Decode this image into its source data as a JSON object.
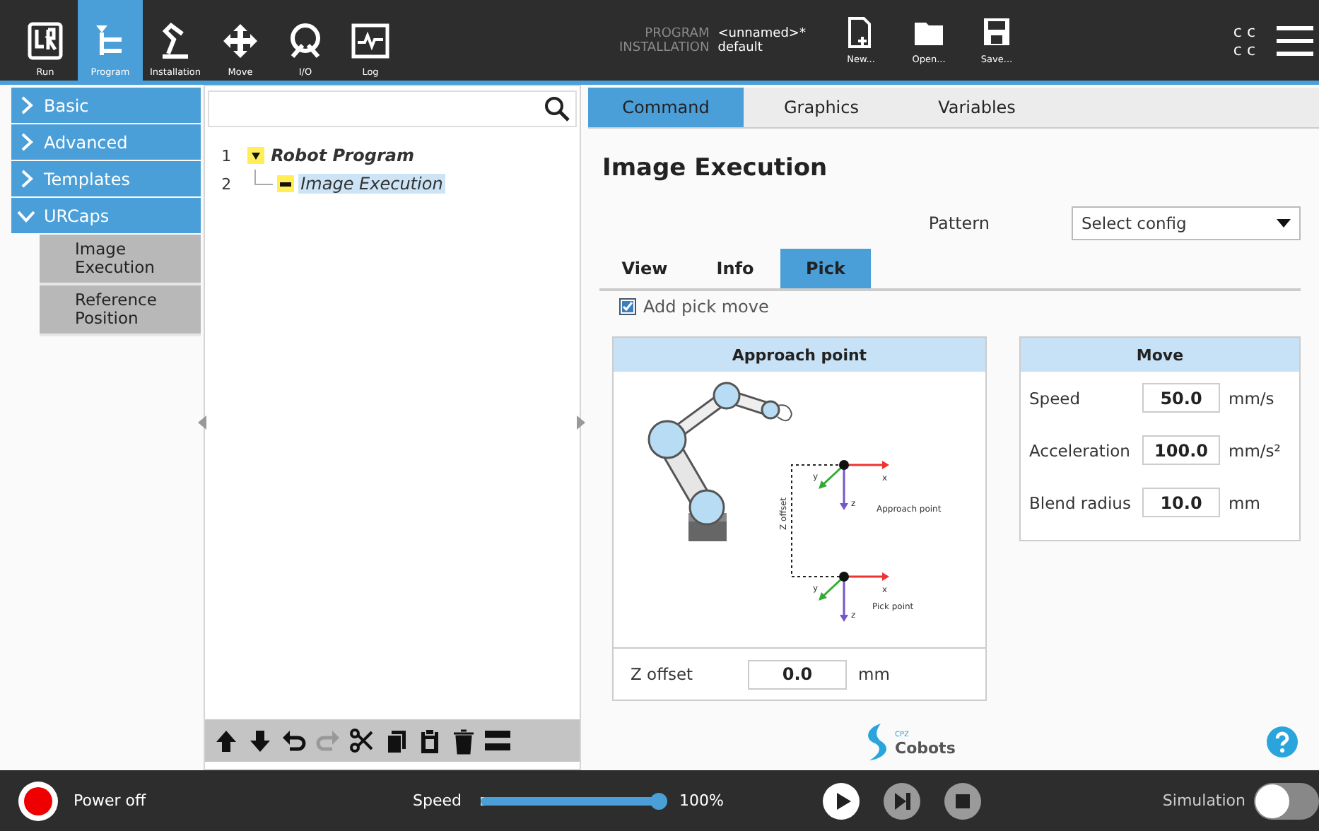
{
  "header": {
    "nav": [
      {
        "label": "Run",
        "kind": "run",
        "selected": false
      },
      {
        "label": "Program",
        "kind": "program",
        "selected": true
      },
      {
        "label": "Installation",
        "kind": "installation",
        "selected": false
      },
      {
        "label": "Move",
        "kind": "move",
        "selected": false
      },
      {
        "label": "I/O",
        "kind": "io",
        "selected": false
      },
      {
        "label": "Log",
        "kind": "log",
        "selected": false
      }
    ],
    "program": {
      "label": "PROGRAM",
      "value": "<unnamed>*"
    },
    "installation": {
      "label": "INSTALLATION",
      "value": "default"
    },
    "files": [
      {
        "label": "New...",
        "kind": "new"
      },
      {
        "label": "Open...",
        "kind": "open"
      },
      {
        "label": "Save...",
        "kind": "save"
      }
    ],
    "status_marks": [
      "c c",
      "c c"
    ]
  },
  "sidebar": [
    {
      "label": "Basic",
      "expanded": false
    },
    {
      "label": "Advanced",
      "expanded": false
    },
    {
      "label": "Templates",
      "expanded": false
    },
    {
      "label": "URCaps",
      "expanded": true,
      "children": [
        {
          "label": "Image Execution"
        },
        {
          "label": "Reference Position"
        }
      ]
    }
  ],
  "tree": [
    {
      "number": "1",
      "label": "Robot Program",
      "expanded": true,
      "selected": false,
      "children": [
        {
          "number": "2",
          "label": "Image Execution",
          "selected": true
        }
      ]
    }
  ],
  "toolbar": [
    {
      "kind": "up",
      "disabled": false
    },
    {
      "kind": "down",
      "disabled": false
    },
    {
      "kind": "undo",
      "disabled": false
    },
    {
      "kind": "redo",
      "disabled": true
    },
    {
      "kind": "cut",
      "disabled": false
    },
    {
      "kind": "copy",
      "disabled": false
    },
    {
      "kind": "paste",
      "disabled": false
    },
    {
      "kind": "delete",
      "disabled": false
    },
    {
      "kind": "suppress",
      "disabled": false
    }
  ],
  "tabs": [
    {
      "label": "Command",
      "selected": true
    },
    {
      "label": "Graphics",
      "selected": false
    },
    {
      "label": "Variables",
      "selected": false
    }
  ],
  "command": {
    "title": "Image Execution",
    "pattern": {
      "label": "Pattern",
      "value": "Select config"
    },
    "subtabs": [
      {
        "label": "View",
        "selected": false
      },
      {
        "label": "Info",
        "selected": false
      },
      {
        "label": "Pick",
        "selected": true
      }
    ],
    "add_pick_move": {
      "label": "Add pick move",
      "checked": true
    },
    "approach": {
      "title": "Approach point",
      "diagram": {
        "offset_label": "Z offset",
        "approach": {
          "x": "x",
          "y": "y",
          "z": "z",
          "label": "Approach point"
        },
        "pick": {
          "x": "x",
          "y": "y",
          "z": "z",
          "label": "Pick point"
        }
      },
      "z_offset": {
        "label": "Z offset",
        "value": "0.0",
        "unit": "mm"
      }
    },
    "move": {
      "title": "Move",
      "rows": [
        {
          "label": "Speed",
          "value": "50.0",
          "unit": "mm/s"
        },
        {
          "label": "Acceleration",
          "value": "100.0",
          "unit": "mm/s²"
        },
        {
          "label": "Blend radius",
          "value": "10.0",
          "unit": "mm"
        }
      ]
    },
    "logo": {
      "small": "CPZ",
      "text": "Cobots"
    }
  },
  "footer": {
    "power": "Power off",
    "speed": {
      "label": "Speed",
      "level": 1.0,
      "reading": "100%"
    },
    "playback": [
      {
        "kind": "play",
        "disabled": false
      },
      {
        "kind": "step",
        "disabled": true
      },
      {
        "kind": "stop",
        "disabled": true
      }
    ],
    "simulation": {
      "label": "Simulation",
      "on": false
    }
  }
}
